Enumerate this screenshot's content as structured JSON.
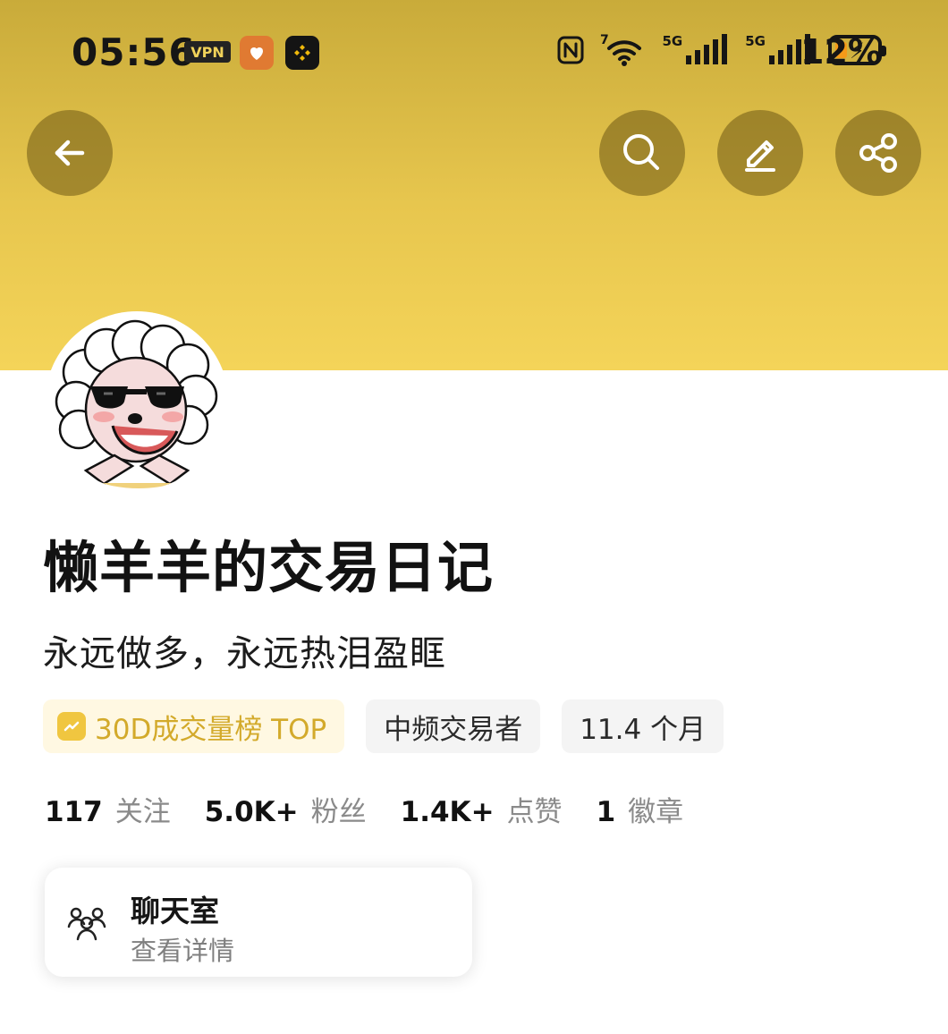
{
  "status_bar": {
    "time": "05:56",
    "vpn": "VPN",
    "battery": "12%",
    "network_1": "5G",
    "network_2": "5G",
    "wifi_badge": "7"
  },
  "header": {
    "back_icon": "arrow-left-icon",
    "search_icon": "search-icon",
    "edit_icon": "pencil-icon",
    "share_icon": "share-icon",
    "bg_top_color": "#c9ab3a",
    "bg_bottom_color": "#f4d459"
  },
  "profile": {
    "name": "懒羊羊的交易日记",
    "bio": "永远做多，永远热泪盈眶",
    "tags": [
      "30D成交量榜 TOP",
      "中频交易者",
      "11.4 个月"
    ],
    "stats": [
      {
        "value": "117",
        "label": "关注"
      },
      {
        "value": "5.0K+",
        "label": "粉丝"
      },
      {
        "value": "1.4K+",
        "label": "点赞"
      },
      {
        "value": "1",
        "label": "徽章"
      }
    ]
  },
  "chatroom": {
    "title": "聊天室",
    "subtitle": "查看详情",
    "icon": "group-icon"
  }
}
